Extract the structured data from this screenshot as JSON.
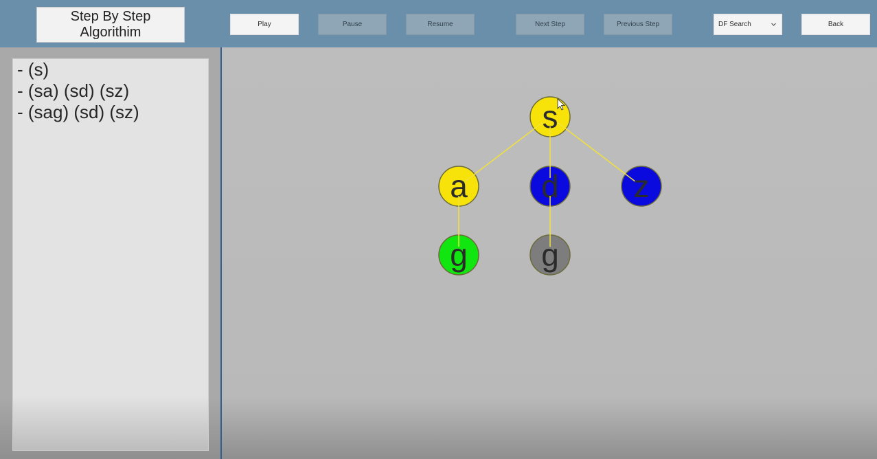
{
  "header": {
    "title_line1": "Step By Step",
    "title_line2": "Algorithim",
    "buttons": {
      "play": "Play",
      "pause": "Pause",
      "resume": "Resume",
      "next_step": "Next Step",
      "previous_step": "Previous Step",
      "back": "Back"
    },
    "algorithm_select": {
      "selected": "DF Search"
    }
  },
  "steps_panel": {
    "lines": [
      "- (s)",
      "- (sa) (sd) (sz)",
      "- (sag) (sd) (sz)"
    ]
  },
  "graph": {
    "nodes": [
      {
        "id": "s",
        "label": "s",
        "color": "#f7e30a"
      },
      {
        "id": "a",
        "label": "a",
        "color": "#f7e30a"
      },
      {
        "id": "d",
        "label": "d",
        "color": "#0a0adf"
      },
      {
        "id": "z",
        "label": "z",
        "color": "#0a0adf"
      },
      {
        "id": "g1",
        "label": "g",
        "color": "#11e611"
      },
      {
        "id": "g2",
        "label": "g",
        "color": "#7d7d7d"
      }
    ],
    "edges": [
      [
        "s",
        "a"
      ],
      [
        "s",
        "d"
      ],
      [
        "s",
        "z"
      ],
      [
        "a",
        "g1"
      ],
      [
        "d",
        "g2"
      ]
    ],
    "edge_color": "#f2e23a"
  }
}
